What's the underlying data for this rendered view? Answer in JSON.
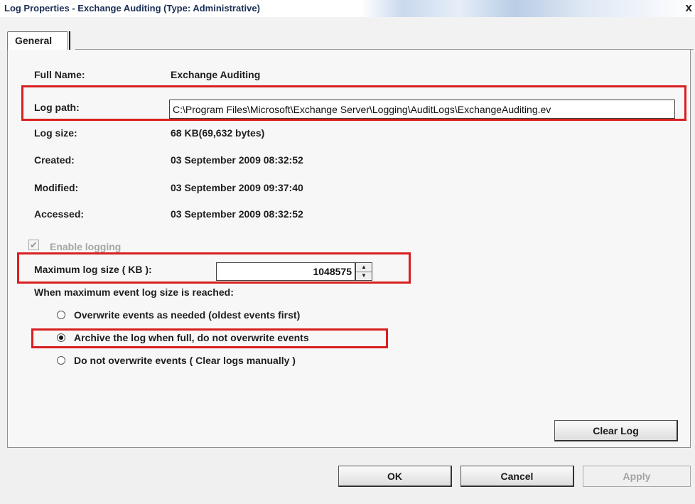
{
  "window": {
    "title": "Log Properties - Exchange Auditing (Type: Administrative)",
    "close_glyph": "x"
  },
  "tabs": [
    {
      "label": "General",
      "selected": true
    }
  ],
  "general": {
    "full_name_label": "Full Name:",
    "full_name_value": "Exchange Auditing",
    "log_path_label": "Log path:",
    "log_path_value": "C:\\Program Files\\Microsoft\\Exchange Server\\Logging\\AuditLogs\\ExchangeAuditing.ev",
    "log_size_label": "Log size:",
    "log_size_value": "68 KB(69,632 bytes)",
    "created_label": "Created:",
    "created_value": "03 September 2009 08:32:52",
    "modified_label": "Modified:",
    "modified_value": "03 September 2009 09:37:40",
    "accessed_label": "Accessed:",
    "accessed_value": "03 September 2009 08:32:52",
    "enable_logging_label": "Enable logging",
    "enable_logging_checked": true,
    "max_size_label": "Maximum log size ( KB ):",
    "max_size_value": "1048575",
    "when_full_label": "When maximum event log size is reached:",
    "options": [
      {
        "label": "Overwrite events as needed (oldest events first)",
        "selected": false
      },
      {
        "label": "Archive the log when full, do not overwrite events",
        "selected": true
      },
      {
        "label": "Do not overwrite events ( Clear logs manually )",
        "selected": false
      }
    ],
    "clear_log_label": "Clear Log"
  },
  "footer": {
    "ok_label": "OK",
    "cancel_label": "Cancel",
    "apply_label": "Apply"
  },
  "colors": {
    "highlight": "#d81f1f",
    "title_text": "#1c2f55",
    "disabled_text": "#a6a6a6"
  },
  "icons": {
    "close": "close-icon",
    "checkbox": "checkmark-icon",
    "spin_up": "spin-up-arrow-icon",
    "spin_down": "spin-down-arrow-icon"
  }
}
